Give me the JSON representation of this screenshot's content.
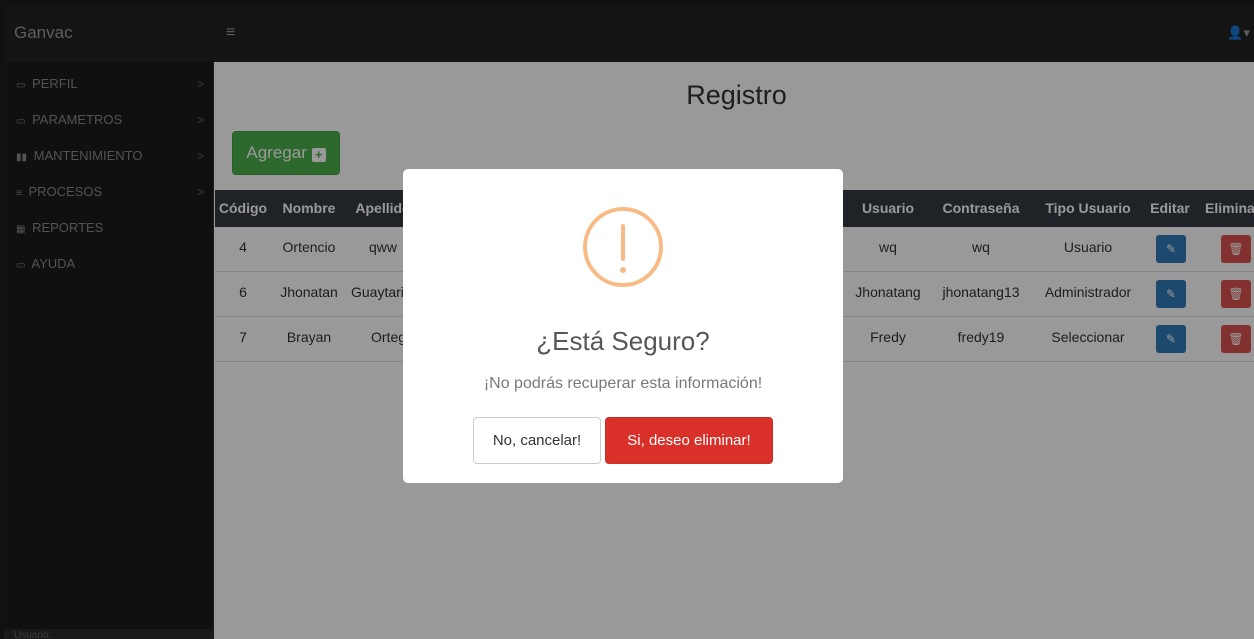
{
  "topbar": {
    "brand": "Ganvac",
    "menu_toggle": "≡",
    "user_menu": "👤▾"
  },
  "sidebar": {
    "items": [
      {
        "icon": "▭",
        "label": "PERFIL",
        "chevron": ">"
      },
      {
        "icon": "▭",
        "label": "PARAMETROS",
        "chevron": ">"
      },
      {
        "icon": "▮▮",
        "label": "MANTENIMIENTO",
        "chevron": ">"
      },
      {
        "icon": "≡",
        "label": "PROCESOS",
        "chevron": ">"
      },
      {
        "icon": "▦",
        "label": "REPORTES",
        "chevron": ""
      },
      {
        "icon": "▭",
        "label": "AYUDA",
        "chevron": ""
      }
    ],
    "footer": "Usuario:"
  },
  "main": {
    "title": "Registro",
    "add_button": "Agregar",
    "add_icon": "+"
  },
  "table": {
    "headers": [
      "Código",
      "Nombre",
      "Apellido",
      "Usuario",
      "Contraseña",
      "Tipo Usuario",
      "Editar",
      "Eliminar"
    ],
    "rows": [
      {
        "codigo": "4",
        "nombre": "Ortencio",
        "apellido": "qww",
        "usuario": "wq",
        "contrasena": "wq",
        "tipo": "Usuario"
      },
      {
        "codigo": "6",
        "nombre": "Jhonatan",
        "apellido": "Guaytarilla",
        "usuario": "Jhonatang",
        "contrasena": "jhonatang13",
        "tipo": "Administrador"
      },
      {
        "codigo": "7",
        "nombre": "Brayan",
        "apellido": "Ortega",
        "usuario": "Fredy",
        "contrasena": "fredy19",
        "tipo": "Seleccionar"
      }
    ],
    "edit_icon": "✎",
    "delete_icon": "🗑"
  },
  "modal": {
    "title": "¿Está Seguro?",
    "text": "¡No podrás recuperar esta información!",
    "cancel": "No, cancelar!",
    "confirm": "Si, deseo eliminar!"
  },
  "colors": {
    "accent_green": "#4cae4c",
    "edit_blue": "#337ab7",
    "delete_red": "#d9534f",
    "confirm_red": "#d9302a",
    "warning": "#f8bb86"
  }
}
